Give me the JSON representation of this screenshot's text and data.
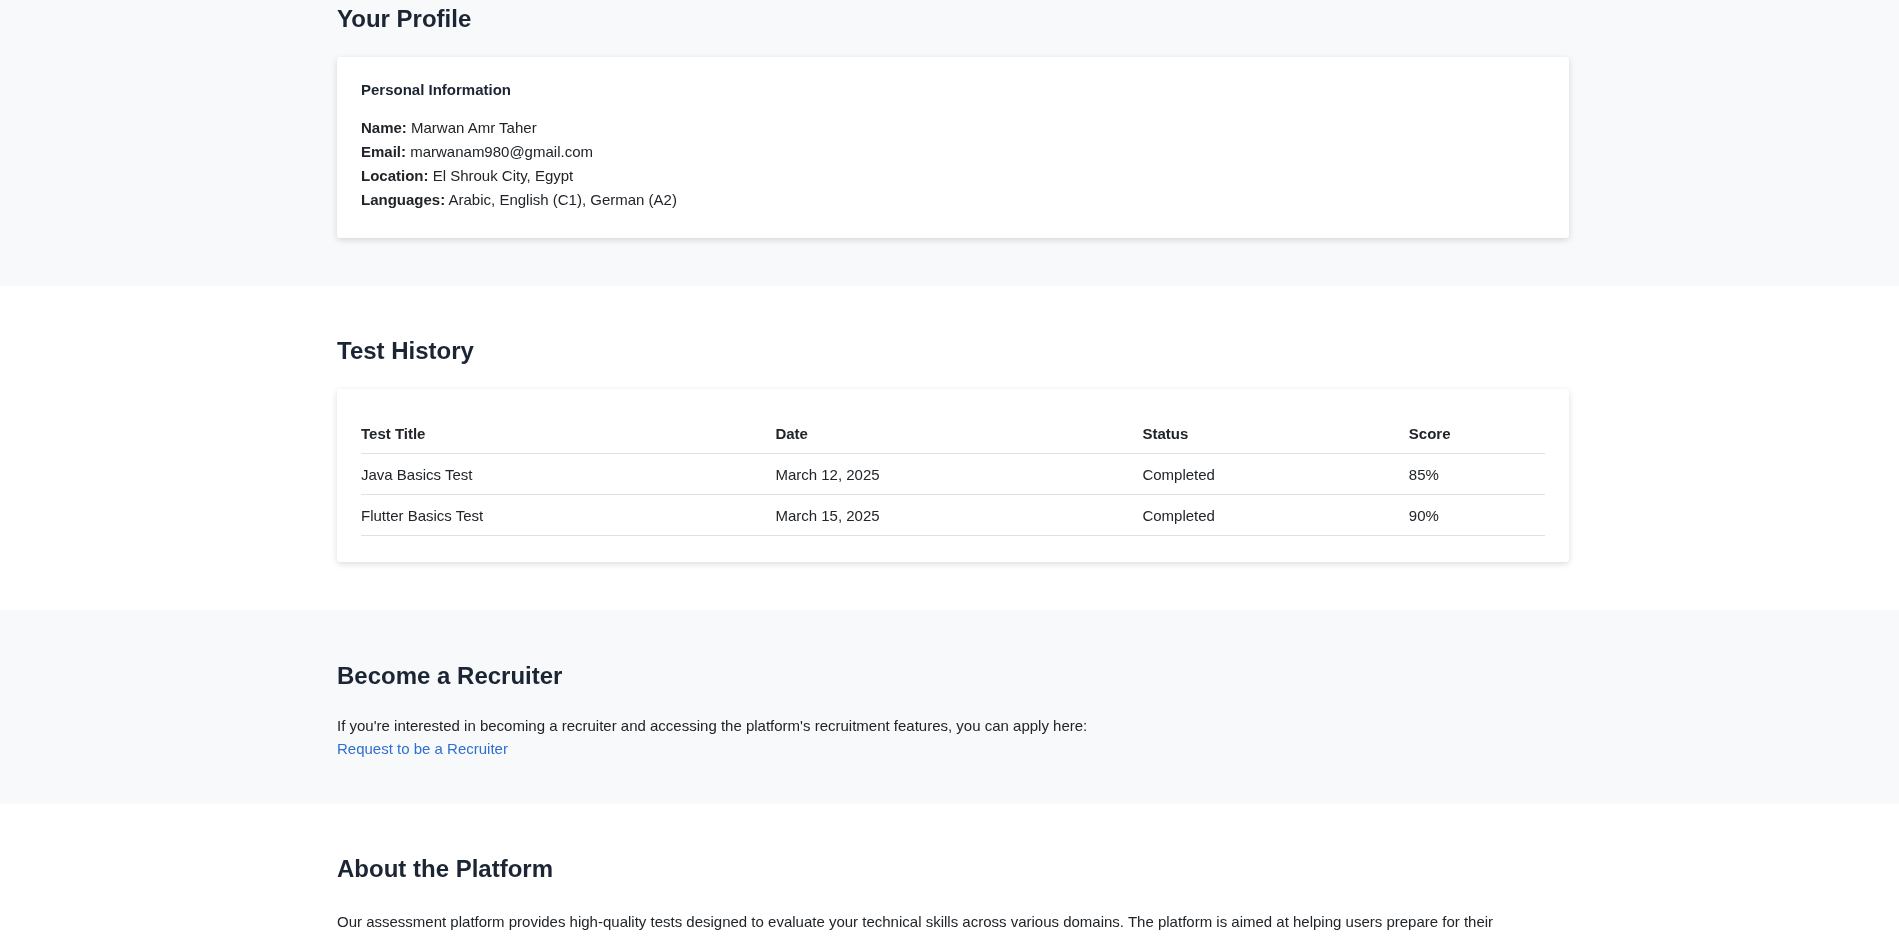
{
  "profile": {
    "title": "Your Profile",
    "card_title": "Personal Information",
    "fields": [
      "**Name:** Marwan Amr Taher",
      "**Email:** marwanam980@gmail.com",
      "**Location:** El Shrouk City, Egypt",
      "**Languages:** Arabic, English (C1), German (A2)"
    ]
  },
  "test_history": {
    "title": "Test History",
    "columns": [
      "Test Title",
      "Date",
      "Status",
      "Score"
    ],
    "rows": [
      [
        "Java Basics Test",
        "March 12, 2025",
        "Completed",
        "85%"
      ],
      [
        "Flutter Basics Test",
        "March 15, 2025",
        "Completed",
        "90%"
      ]
    ]
  },
  "recruiter": {
    "title": "Become a Recruiter",
    "text": "If you're interested in becoming a recruiter and accessing the platform's recruitment features, you can apply here:",
    "link": "Request to be a Recruiter"
  },
  "about": {
    "title": "About the Platform",
    "text": "Our assessment platform provides high-quality tests designed to evaluate your technical skills across various domains. The platform is aimed at helping users prepare for their"
  }
}
